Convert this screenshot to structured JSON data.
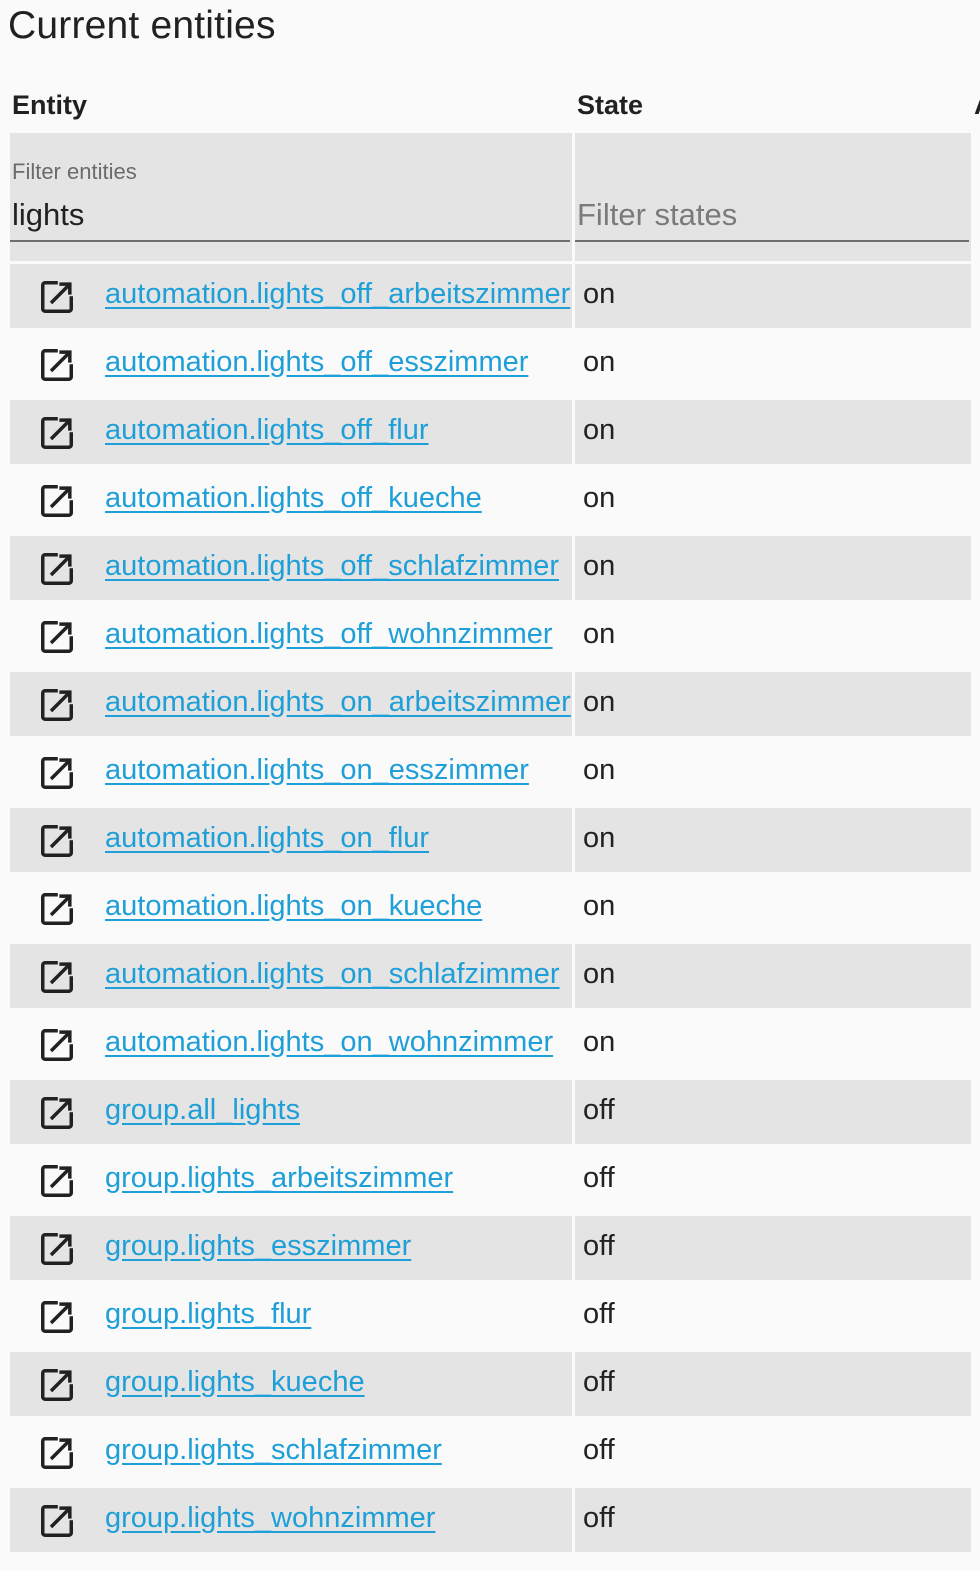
{
  "page": {
    "title": "Current entities"
  },
  "table": {
    "headers": {
      "entity": "Entity",
      "state": "State",
      "attributes": "A"
    },
    "filters": {
      "entity_label": "Filter entities",
      "entity_value": "lights",
      "state_placeholder": "Filter states"
    },
    "rows": [
      {
        "entity": "automation.lights_off_arbeitszimmer",
        "state": "on"
      },
      {
        "entity": "automation.lights_off_esszimmer",
        "state": "on"
      },
      {
        "entity": "automation.lights_off_flur",
        "state": "on"
      },
      {
        "entity": "automation.lights_off_kueche",
        "state": "on"
      },
      {
        "entity": "automation.lights_off_schlafzimmer",
        "state": "on"
      },
      {
        "entity": "automation.lights_off_wohnzimmer",
        "state": "on"
      },
      {
        "entity": "automation.lights_on_arbeitszimmer",
        "state": "on"
      },
      {
        "entity": "automation.lights_on_esszimmer",
        "state": "on"
      },
      {
        "entity": "automation.lights_on_flur",
        "state": "on"
      },
      {
        "entity": "automation.lights_on_kueche",
        "state": "on"
      },
      {
        "entity": "automation.lights_on_schlafzimmer",
        "state": "on"
      },
      {
        "entity": "automation.lights_on_wohnzimmer",
        "state": "on"
      },
      {
        "entity": "group.all_lights",
        "state": "off"
      },
      {
        "entity": "group.lights_arbeitszimmer",
        "state": "off"
      },
      {
        "entity": "group.lights_esszimmer",
        "state": "off"
      },
      {
        "entity": "group.lights_flur",
        "state": "off"
      },
      {
        "entity": "group.lights_kueche",
        "state": "off"
      },
      {
        "entity": "group.lights_schlafzimmer",
        "state": "off"
      },
      {
        "entity": "group.lights_wohnzimmer",
        "state": "off"
      }
    ]
  },
  "icons": {
    "row_icon": "open-in-new-icon"
  },
  "colors": {
    "link": "#1e9fd8",
    "shaded_row": "#e4e4e4",
    "background": "#fafafa",
    "text": "#212121"
  }
}
